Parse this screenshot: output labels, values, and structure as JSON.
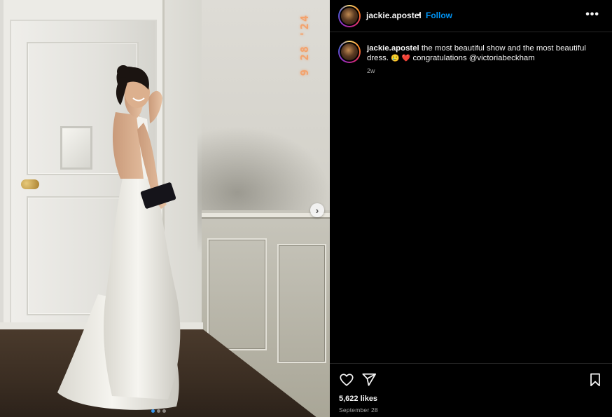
{
  "post": {
    "username": "jackie.apostel",
    "separator": "•",
    "follow_label": "Follow",
    "more_label": "•••",
    "caption_text": "the most beautiful show and the most beautiful dress.",
    "caption_emoji_1": "🥲",
    "caption_emoji_2": "❤️",
    "caption_tail": "congratulations @victoriabeckham",
    "time_ago": "2w",
    "likes": "5,622 likes",
    "date": "September 28"
  },
  "photo": {
    "datestamp": "9 28 '24",
    "next_icon": "chevron-right-icon",
    "carousel": {
      "count": 3,
      "active_index": 0
    }
  },
  "icons": {
    "like": "heart-icon",
    "share": "paper-plane-icon",
    "save": "bookmark-icon"
  },
  "colors": {
    "background": "#000000",
    "text": "#f5f5f5",
    "muted": "#a8a8a8",
    "link": "#0095f6",
    "datestamp": "#f3a26c"
  }
}
